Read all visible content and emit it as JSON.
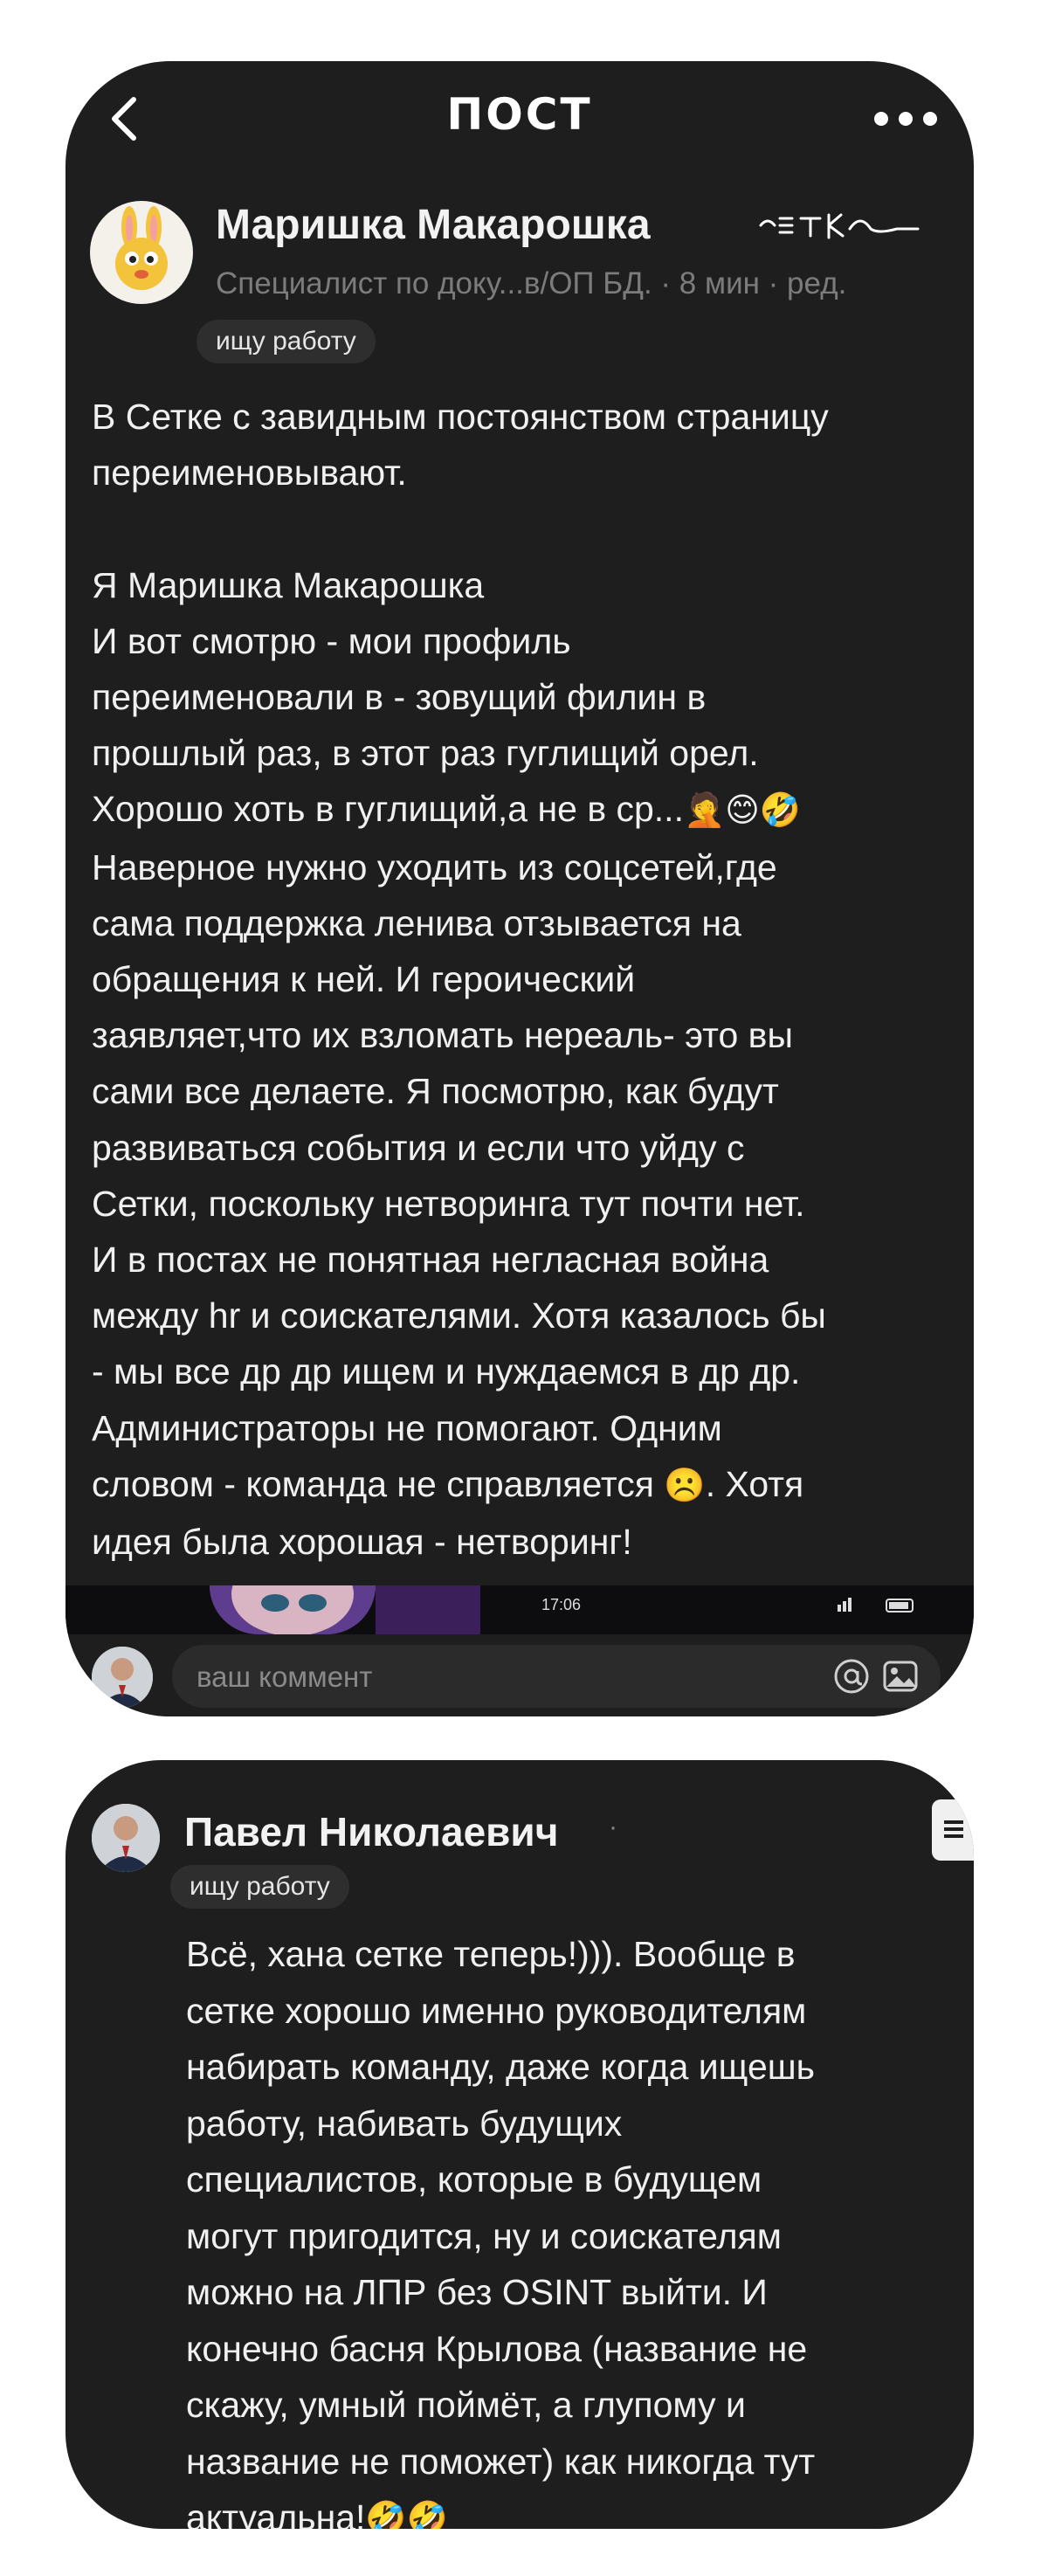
{
  "header": {
    "title": "ПОСТ",
    "back_icon": "chevron-left-icon",
    "more_icon": "more-dots-icon"
  },
  "post": {
    "author": "Маришка Макарошка",
    "brand": "сеТКа",
    "meta": "Специалист по доку...в/ОП БД. · 8 мин · ред.",
    "badge": "ищу работу",
    "paragraph1": "В Сетке с завидным постоянством страницу\nпереименовывают.",
    "body_lines": [
      "Я Маришка Макарошка",
      "И вот смотрю - мои профиль",
      "переименовали в - зовущий филин в",
      "прошлый раз, в этот раз гуглищий орел.",
      "Хорошо хоть в гуглищий,а не в ср...",
      "Наверное нужно уходить из соцсетей,где",
      "сама поддержка ленива отзывается на",
      "обращения к ней. И героический",
      "заявляет,что их взломать нереаль- это вы",
      "сами все делаете. Я посмотрю, как будут",
      "развиваться события и если что уйду с",
      "Сетки, поскольку нетворинга тут почти нет.",
      "И в постах не понятная негласная война",
      "между hr и соискателями. Хотя казалось бы",
      "- мы все др др ищем и нуждаемся в др др.",
      "Администраторы не помогают. Одним",
      "словом - команда не справляется",
      ". Хотя",
      "идея была хорошая - нетворинг!"
    ],
    "emoji_line5": "🤦😊🤣",
    "emoji_sad": "☹️"
  },
  "media_strip": {
    "time": "17:06",
    "status_icons": "signal-battery-icon"
  },
  "comment_bar": {
    "placeholder": "ваш коммент",
    "at_icon": "at-sign-icon",
    "image_icon": "image-icon"
  },
  "reply": {
    "author": "Павел Николаевич",
    "dot": "·",
    "badge": "ищу работу",
    "text": "Всё, хана сетке теперь!))). Вообще в\nсетке хорошо именно руководителям\nнабирать команду, даже когда ищешь\nработу, набивать будущих\nспециалистов, которые в будущем\nмогут пригодится, ну и соискателям\nможно на ЛПР без OSINT выйти. И\nконечно басня Крылова (название не\nскажу, умный поймёт, а глупому и\nназвание не поможет) как никогда тут\nактуальна!",
    "emoji_end": "🤣🤣"
  },
  "colors": {
    "card_bg": "#1e1e1e",
    "page_bg": "#ffffff",
    "meta_gray": "#7c7c7c",
    "badge_bg": "#2e2e2e"
  }
}
